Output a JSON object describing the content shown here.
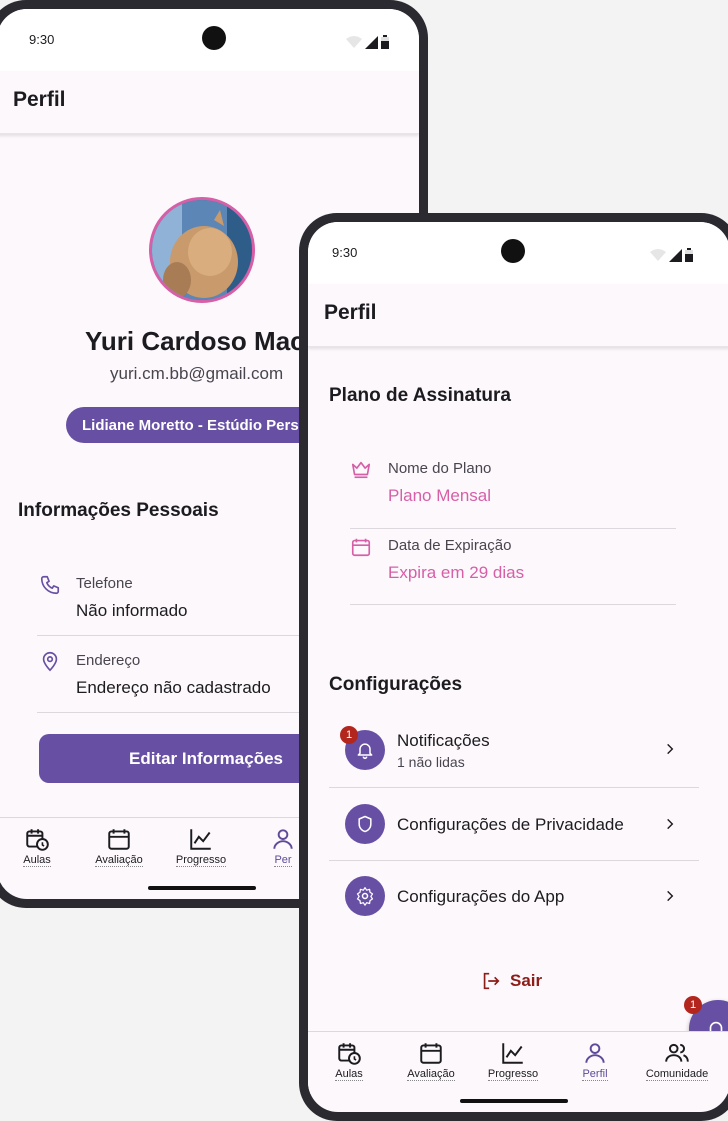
{
  "status": {
    "time": "9:30"
  },
  "back_phone": {
    "title": "Perfil",
    "user": {
      "name": "Yuri Cardoso Mac",
      "email": "yuri.cm.bb@gmail.com",
      "studio": "Lidiane Moretto - Estúdio Pers"
    },
    "personal": {
      "title": "Informações Pessoais",
      "phone": {
        "label": "Telefone",
        "value": "Não informado"
      },
      "address": {
        "label": "Endereço",
        "value": "Endereço não cadastrado"
      }
    },
    "edit_button": "Editar Informações",
    "nav": [
      "Aulas",
      "Avaliação",
      "Progresso",
      "Per"
    ]
  },
  "front_phone": {
    "title": "Perfil",
    "plan": {
      "title": "Plano de Assinatura",
      "name_label": "Nome do Plano",
      "name_value": "Plano Mensal",
      "exp_label": "Data de Expiração",
      "exp_value": "Expira em 29 dias"
    },
    "settings": {
      "title": "Configurações",
      "notifications": {
        "label": "Notificações",
        "sub": "1 não lidas",
        "badge": "1"
      },
      "privacy": {
        "label": "Configurações de Privacidade"
      },
      "app": {
        "label": "Configurações do App"
      }
    },
    "logout": "Sair",
    "fab_badge": "1",
    "nav": [
      "Aulas",
      "Avaliação",
      "Progresso",
      "Perfil",
      "Comunidade"
    ]
  },
  "colors": {
    "primary": "#6750a4",
    "accent": "#d65fa8",
    "logout": "#8c1d18"
  }
}
